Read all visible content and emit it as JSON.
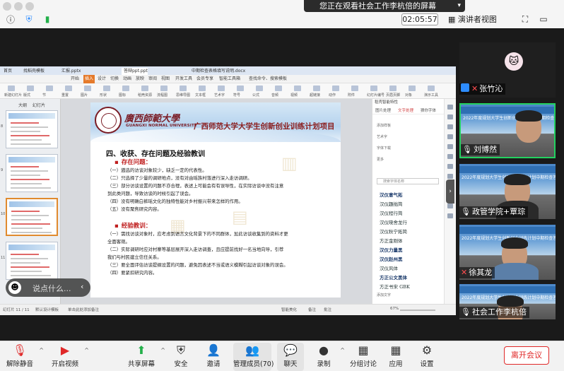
{
  "topbar": {
    "share_banner": "您正在观看社会工作李杭倍的屏幕",
    "timer": "02:05:57",
    "view_button": "演讲者视图"
  },
  "shared_screen": {
    "browser_tabs": [
      "首页",
      "找稻壳模板",
      "汇报.pptx",
      "答辩ppt.ppt",
      "中期检查表格填写说明.docx"
    ],
    "ribbon_menu": [
      "开始",
      "插入",
      "设计",
      "切换",
      "动画",
      "放映",
      "审阅",
      "视图",
      "开发工具",
      "会员专享",
      "智能工具箱",
      "查找命令、搜索模板"
    ],
    "ribbon_tools": [
      "新建幻灯片",
      "版式",
      "节",
      "重置",
      "图片",
      "形状",
      "图标",
      "稻壳资源",
      "流程图",
      "思维导图",
      "文本框",
      "艺术字",
      "符号",
      "公式",
      "音频",
      "视频",
      "超链接",
      "动作",
      "附件",
      "幻灯片编号",
      "页眉页脚",
      "对象",
      "演示工具"
    ],
    "thumbs_header": [
      "大纲",
      "幻灯片"
    ],
    "slide": {
      "univ_name": "廣西師範大學",
      "univ_en": "GUANGXI NORMAL UNIVERSITY",
      "project_title": "广西师范大学大学生创新创业训练计划项目",
      "section_title": "四、收获、存在问题及经验教训",
      "problems_head": "存在问题：",
      "problems": [
        "（一）遴选的访谈对象较少，缺乏一定的代表性。",
        "（二）只选择了少量的调研地点，没有对由瑶族村落进行深入走访调研。",
        "（三）部分访谈设置的问题不亦合理，表述上可能会有有误导性，在实际访谈中没有注意",
        "到此类问题，导致访谈的时候引起了误会。",
        "（四）没有明确白裤瑶文化的独特性能对乡村振兴带来怎样的作用。",
        "（五）没有聚焦研究内容。"
      ],
      "lessons_head": "经验教训：",
      "lessons": [
        "（一）需找访谈对象时，应考虑到语言文化背景下的不同群体，加此访谈收集到的资料才更",
        "全面客观。",
        "（二）实际调研时应对村寨等基层展开深入走访调查，且应提前找好一名当地向导，引荐",
        "我们与村民建立信任关系。",
        "（三）要全面评估访谈提纲设置的问题，避免因表述不当或语义模糊引起访谈对象的误会。",
        "（四）要紧扣研究内容。"
      ]
    },
    "font_panel": {
      "top_label": "稻壳智能特性",
      "tabs": [
        "图片处理",
        "文字处理",
        "猜你字体"
      ],
      "rows": [
        "添加样板",
        "艺术字",
        "字体下载",
        "更多"
      ],
      "search_placeholder": "搜索字体名称",
      "fonts": [
        "汉仪意气拓",
        "汉仪趣拙简",
        "汉仪程行简",
        "汉仪晓舍龙行",
        "汉仪秋宁拓简",
        "方正金刚体",
        "汉仪力量黑",
        "汉仪赵州黑",
        "汉仪风体",
        "方正公文黑体",
        "方正书宋 GBK"
      ],
      "footer": "添加文字"
    },
    "statusbar": [
      "幻灯片 11 / 11",
      "默认设计模板",
      "单击此处添加备注",
      "智能美化",
      "备注",
      "批注",
      "67%"
    ]
  },
  "comment": {
    "placeholder": "说点什么...",
    "avatar_icon": "smile-icon"
  },
  "participants": [
    {
      "name": "张竹沁",
      "mic": "muted",
      "type": "avatar"
    },
    {
      "name": "刘博然",
      "mic": "on",
      "type": "video",
      "active": true,
      "banner": "2022年度规划大学生创新创业训练计划中期检查答辩"
    },
    {
      "name": "政管学院+覃琮",
      "mic": "on",
      "type": "video",
      "banner": "2022年度规划大学生创新创业训练计划中期检查答辩"
    },
    {
      "name": "徐其龙",
      "mic": "muted",
      "type": "video",
      "banner": "2022年度规划大学生创新创业训练计划中期检查答辩"
    },
    {
      "name": "社会工作李杭倍",
      "mic": "on",
      "type": "video",
      "banner": "2022年度规划大学生创新创业训练计划中期检查答辩"
    }
  ],
  "bottombar": {
    "items": [
      {
        "label": "解除静音",
        "icon": "mic-muted-icon"
      },
      {
        "label": "开启视频",
        "icon": "video-off-icon"
      },
      {
        "label": "共享屏幕",
        "icon": "share-screen-icon"
      },
      {
        "label": "安全",
        "icon": "shield-icon"
      },
      {
        "label": "邀请",
        "icon": "invite-icon"
      },
      {
        "label": "管理成员(70)",
        "icon": "participants-icon"
      },
      {
        "label": "聊天",
        "icon": "chat-icon"
      },
      {
        "label": "录制",
        "icon": "record-icon"
      },
      {
        "label": "分组讨论",
        "icon": "breakout-icon"
      },
      {
        "label": "应用",
        "icon": "apps-icon"
      },
      {
        "label": "设置",
        "icon": "gear-icon"
      }
    ],
    "leave": "离开会议"
  },
  "colors": {
    "active_border": "#23d160",
    "leave": "#e02828",
    "muted": "#ff4d4f",
    "slide_title": "#8b1d1d"
  }
}
